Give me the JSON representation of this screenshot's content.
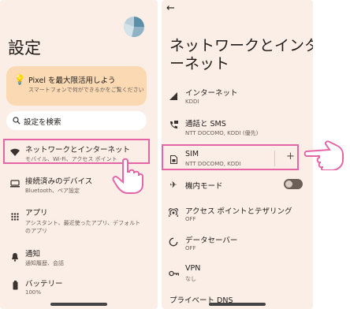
{
  "left": {
    "title": "設定",
    "pixel_card": {
      "title": "Pixel を最大限活用しよう",
      "subtitle": "スマートフォンで何ができるかをご覧ください"
    },
    "search_placeholder": "設定を検索",
    "items": [
      {
        "title": "ネットワークとインターネット",
        "subtitle": "モバイル、Wi-Fi、アクセス ポイント"
      },
      {
        "title": "接続済みのデバイス",
        "subtitle": "Bluetooth、ペア設定"
      },
      {
        "title": "アプリ",
        "subtitle": "アシスタント、最近使ったアプリ、デフォルトのアプリ"
      },
      {
        "title": "通知",
        "subtitle": "通知履歴、会話"
      },
      {
        "title": "バッテリー",
        "subtitle": "100%"
      }
    ]
  },
  "right": {
    "back": "←",
    "title_line1": "ネットワークとインタ",
    "title_line2": "ーネット",
    "items": [
      {
        "title": "インターネット",
        "subtitle": "KDDI"
      },
      {
        "title": "通話と SMS",
        "subtitle": "NTT DOCOMO, KDDI (優先)"
      },
      {
        "title": "SIM",
        "subtitle": "NTT DOCOMO, KDDI",
        "action": "+"
      },
      {
        "title": "機内モード",
        "subtitle": ""
      },
      {
        "title": "アクセス ポイントとテザリング",
        "subtitle": "OFF"
      },
      {
        "title": "データセーバー",
        "subtitle": "OFF"
      },
      {
        "title": "VPN",
        "subtitle": "なし"
      },
      {
        "title": "プライベート DNS",
        "subtitle": ""
      }
    ],
    "airplane_on": false
  },
  "colors": {
    "highlight": "#e466a6",
    "background": "#fbeee6",
    "card": "#fbd9b3"
  }
}
